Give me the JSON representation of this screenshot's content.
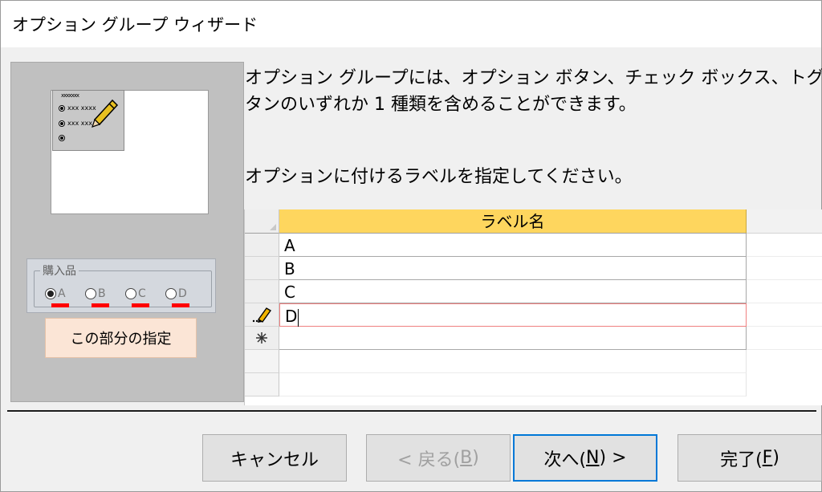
{
  "window": {
    "title": "オプション グループ ウィザード"
  },
  "preview": {
    "sample_caption": "xxxxxxx",
    "sample_rows": [
      "xxx xxxx",
      "xxx xxx",
      ""
    ],
    "group_legend": "購入品",
    "options": [
      {
        "label": "A",
        "checked": true
      },
      {
        "label": "B",
        "checked": false
      },
      {
        "label": "C",
        "checked": false
      },
      {
        "label": "D",
        "checked": false
      }
    ],
    "note": "この部分の指定",
    "mark_color": "#ff0000"
  },
  "instructions": {
    "line1": "オプション グループには、オプション ボタン、チェック ボックス、トグル ボ",
    "line2": "タンのいずれか 1 種類を含めることができます。",
    "line3": "オプションに付けるラベルを指定してください。"
  },
  "grid": {
    "header": "ラベル名",
    "header_color": "#fed65e",
    "rows": [
      "A",
      "B",
      "C",
      "D"
    ],
    "editing_row_icon": "pencil-icon",
    "new_row_icon": "asterisk-icon"
  },
  "buttons": {
    "cancel": "キャンセル",
    "back_pre": "< 戻る(",
    "back_key": "B",
    "back_post": ")",
    "next_pre": "次へ(",
    "next_key": "N",
    "next_post": ") >",
    "finish_pre": "完了(",
    "finish_key": "F",
    "finish_post": ")"
  }
}
